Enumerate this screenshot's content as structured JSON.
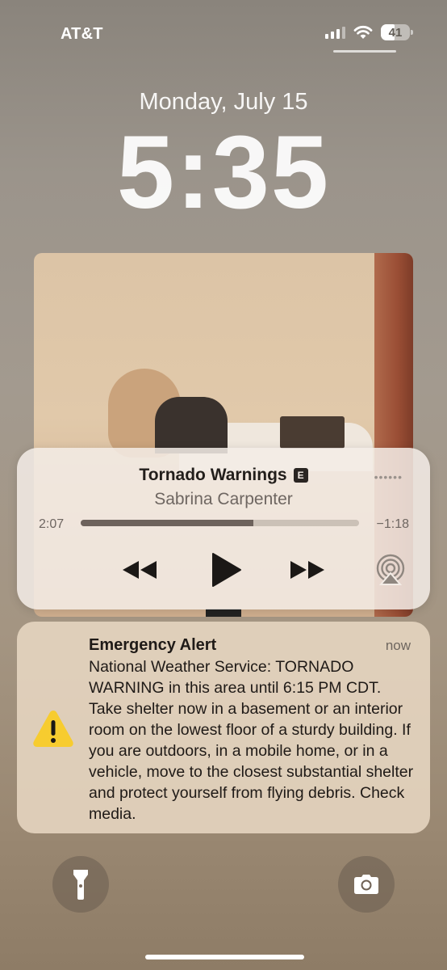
{
  "status_bar": {
    "carrier": "AT&T",
    "battery": "41",
    "icons": [
      "signal-icon",
      "wifi-icon",
      "battery-icon"
    ]
  },
  "lock_screen": {
    "date": "Monday, July 15",
    "time": "5:35"
  },
  "now_playing": {
    "title": "Tornado Warnings",
    "explicit_badge": "E",
    "artist": "Sabrina Carpenter",
    "elapsed": "2:07",
    "remaining": "−1:18",
    "progress": 0.62,
    "controls": [
      "rewind-icon",
      "play-icon",
      "fast-forward-icon",
      "airplay-icon"
    ]
  },
  "notification": {
    "title": "Emergency Alert",
    "time": "now",
    "body": "National Weather Service: TORNADO WARNING in this area until 6:15 PM CDT. Take shelter now in a basement or an interior room on the lowest floor of a sturdy building. If you are outdoors, in a mobile home, or in a vehicle, move to the closest substantial shelter and protect yourself from flying debris. Check media.",
    "icon": "warning-icon",
    "icon_color": "#f7cc2f"
  },
  "bottom_controls": [
    "flashlight-icon",
    "camera-icon"
  ]
}
